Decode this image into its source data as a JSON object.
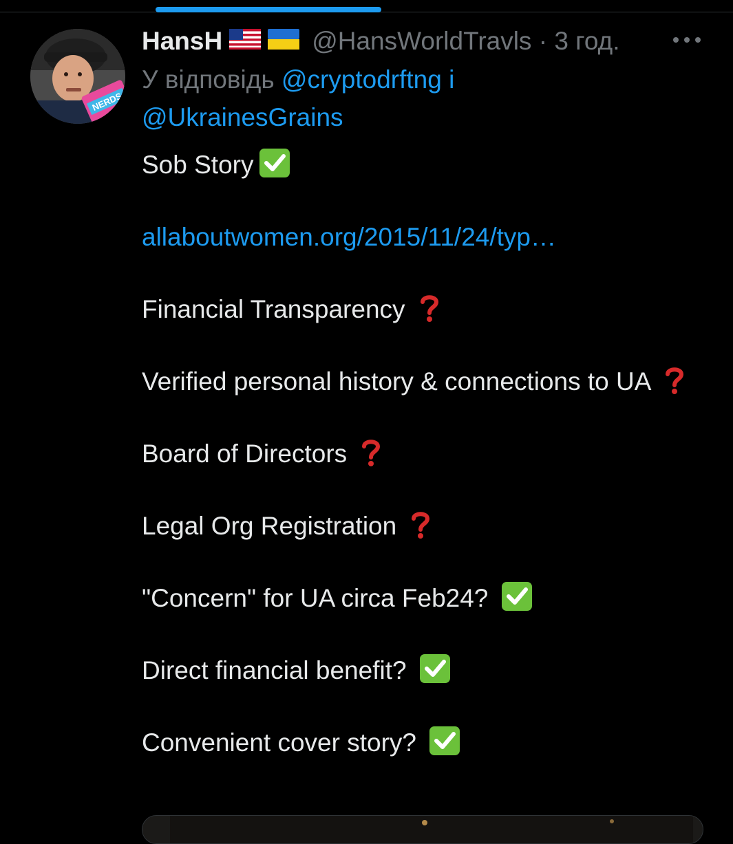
{
  "tweet": {
    "display_name": "HansH",
    "flags": [
      "us-flag-icon",
      "ukraine-flag-icon"
    ],
    "handle_time": "@HansWorldTravls · 3 год.",
    "reply_prefix": "У відповідь",
    "reply_mentions": [
      "@cryptodrftng",
      "@UkrainesGrains"
    ],
    "reply_joiner": "і",
    "paragraphs": [
      {
        "text": "Sob Story",
        "emoji": "check"
      },
      {
        "text": "allaboutwomen.org/2015/11/24/typ…",
        "link": true
      },
      {
        "text": "Financial Transparency ",
        "emoji": "question"
      },
      {
        "text": "Verified personal history & connections to UA ",
        "emoji": "question"
      },
      {
        "text": "Board of Directors ",
        "emoji": "question"
      },
      {
        "text": "Legal Org Registration ",
        "emoji": "question"
      },
      {
        "text": "\"Concern\" for UA circa Feb24? ",
        "emoji": "check"
      },
      {
        "text": "Direct financial benefit? ",
        "emoji": "check"
      },
      {
        "text": "Convenient cover story? ",
        "emoji": "check"
      }
    ]
  },
  "icons": {
    "more": "more-options-icon",
    "check": "check-mark-icon",
    "question": "question-mark-icon"
  },
  "colors": {
    "background": "#000000",
    "text": "#e7e9ea",
    "muted": "#71767b",
    "link": "#1d9bf0",
    "check_green": "#6bc13a",
    "question_red": "#d72a2a"
  }
}
